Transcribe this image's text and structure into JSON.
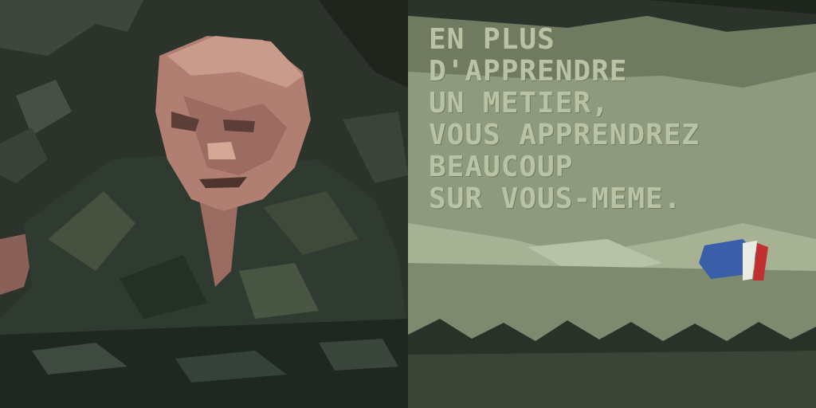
{
  "headline": {
    "lines": [
      "EN PLUS",
      "D'APPRENDRE",
      "UN METIER,",
      "VOUS APPRENDREZ",
      "BEAUCOUP",
      "SUR VOUS-MEME."
    ]
  },
  "colors": {
    "background_dark": "#2c3128",
    "text_panel": "#8e9a7e",
    "text_fill": "#b9c3a4",
    "skin": "#b07f72",
    "uniform": "#2f3a30",
    "flag_blue": "#3a5ea8",
    "flag_red": "#c03030"
  },
  "icons": {
    "emblem": "tricolor-emblem-icon"
  }
}
